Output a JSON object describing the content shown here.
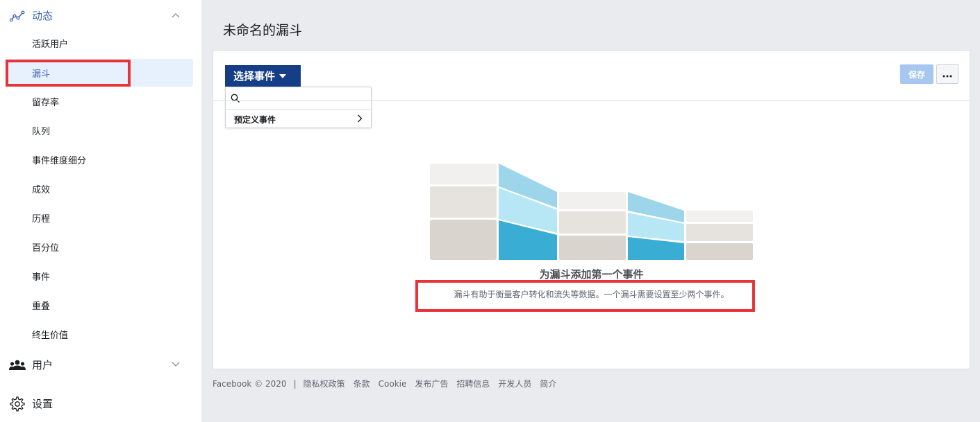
{
  "sidebar": {
    "section_activity": "动态",
    "activity_items": [
      {
        "label": "活跃用户"
      },
      {
        "label": "漏斗"
      },
      {
        "label": "留存率"
      },
      {
        "label": "队列"
      },
      {
        "label": "事件维度细分"
      },
      {
        "label": "成效"
      },
      {
        "label": "历程"
      },
      {
        "label": "百分位"
      },
      {
        "label": "事件"
      },
      {
        "label": "重叠"
      },
      {
        "label": "终生价值"
      }
    ],
    "active_item": "漏斗",
    "section_users": "用户",
    "section_settings": "设置"
  },
  "page": {
    "title": "未命名的漏斗"
  },
  "toolbar": {
    "select_event_label": "选择事件",
    "save_label": "保存"
  },
  "dropdown": {
    "search_placeholder": "",
    "items": [
      {
        "label": "预定义事件"
      }
    ]
  },
  "empty_state": {
    "title": "为漏斗添加第一个事件",
    "description": "漏斗有助于衡量客户转化和流失等数据。一个漏斗需要设置至少两个事件。"
  },
  "footer": {
    "copyright": "Facebook © 2020",
    "links": [
      "隐私权政策",
      "条款",
      "Cookie",
      "发布广告",
      "招聘信息",
      "开发人员",
      "简介"
    ]
  },
  "colors": {
    "accent": "#4267b2",
    "select_button": "#153e86",
    "save_button_disabled": "#a7c7f0",
    "highlight_box": "#e9333a",
    "active_item_bg": "#e7f0fd"
  }
}
